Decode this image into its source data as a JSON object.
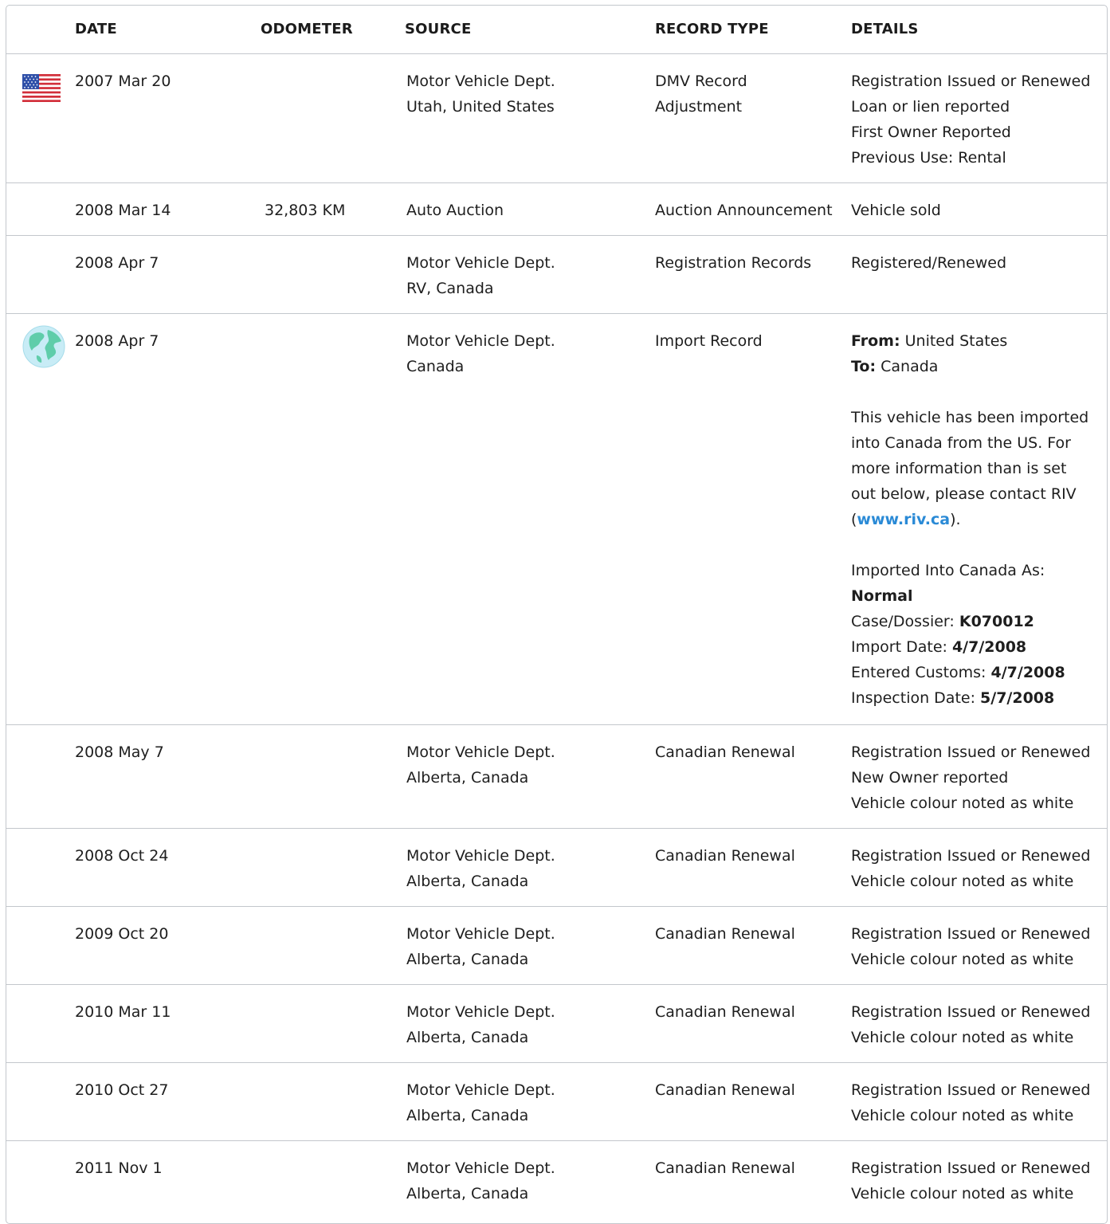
{
  "headers": {
    "date": "DATE",
    "odometer": "ODOMETER",
    "source": "SOURCE",
    "record_type": "RECORD TYPE",
    "details": "DETAILS"
  },
  "icons": {
    "row0": "us-flag-icon",
    "row3": "globe-icon"
  },
  "link_color": "#2a8ad6",
  "rows": [
    {
      "date": "2007 Mar 20",
      "odometer": "",
      "source": [
        "Motor Vehicle Dept.",
        "Utah, United States"
      ],
      "record_type": [
        "DMV Record",
        "Adjustment"
      ],
      "details": [
        "Registration Issued or Renewed",
        "Loan or lien reported",
        "First Owner Reported",
        "Previous Use: Rental"
      ]
    },
    {
      "date": "2008 Mar 14",
      "odometer": "32,803 KM",
      "source": [
        "Auto Auction"
      ],
      "record_type": [
        "Auction Announcement"
      ],
      "details": [
        "Vehicle sold"
      ]
    },
    {
      "date": "2008 Apr 7",
      "odometer": "",
      "source": [
        "Motor Vehicle Dept.",
        "RV, Canada"
      ],
      "record_type": [
        "Registration Records"
      ],
      "details": [
        "Registered/Renewed"
      ]
    },
    {
      "date": "2008 Apr 7",
      "odometer": "",
      "source": [
        "Motor Vehicle Dept.",
        "Canada"
      ],
      "record_type": [
        "Import Record"
      ],
      "import_details": {
        "from_label": "From:",
        "from_value": " United States",
        "to_label": "To:",
        "to_value": " Canada",
        "para_before_link": "This vehicle has been imported into Canada from the US. For more information than is set out below, please contact RIV (",
        "link_text": "www.riv.ca",
        "para_after_link": ").",
        "imported_as_label": "Imported Into Canada As:",
        "imported_as_value": "Normal",
        "case_label": "Case/Dossier: ",
        "case_value": "K070012",
        "import_date_label": "Import Date: ",
        "import_date_value": "4/7/2008",
        "customs_label": "Entered Customs: ",
        "customs_value": "4/7/2008",
        "inspection_label": "Inspection Date: ",
        "inspection_value": "5/7/2008"
      }
    },
    {
      "date": "2008 May 7",
      "odometer": "",
      "source": [
        "Motor Vehicle Dept.",
        "Alberta, Canada"
      ],
      "record_type": [
        "Canadian Renewal"
      ],
      "details": [
        "Registration Issued or Renewed",
        "New Owner reported",
        "Vehicle colour noted as white"
      ]
    },
    {
      "date": "2008 Oct 24",
      "odometer": "",
      "source": [
        "Motor Vehicle Dept.",
        "Alberta, Canada"
      ],
      "record_type": [
        "Canadian Renewal"
      ],
      "details": [
        "Registration Issued or Renewed",
        "Vehicle colour noted as white"
      ]
    },
    {
      "date": "2009 Oct 20",
      "odometer": "",
      "source": [
        "Motor Vehicle Dept.",
        "Alberta, Canada"
      ],
      "record_type": [
        "Canadian Renewal"
      ],
      "details": [
        "Registration Issued or Renewed",
        "Vehicle colour noted as white"
      ]
    },
    {
      "date": "2010 Mar 11",
      "odometer": "",
      "source": [
        "Motor Vehicle Dept.",
        "Alberta, Canada"
      ],
      "record_type": [
        "Canadian Renewal"
      ],
      "details": [
        "Registration Issued or Renewed",
        "Vehicle colour noted as white"
      ]
    },
    {
      "date": "2010 Oct 27",
      "odometer": "",
      "source": [
        "Motor Vehicle Dept.",
        "Alberta, Canada"
      ],
      "record_type": [
        "Canadian Renewal"
      ],
      "details": [
        "Registration Issued or Renewed",
        "Vehicle colour noted as white"
      ]
    },
    {
      "date": "2011 Nov 1",
      "odometer": "",
      "source": [
        "Motor Vehicle Dept.",
        "Alberta, Canada"
      ],
      "record_type": [
        "Canadian Renewal"
      ],
      "details": [
        "Registration Issued or Renewed",
        "Vehicle colour noted as white"
      ]
    }
  ]
}
